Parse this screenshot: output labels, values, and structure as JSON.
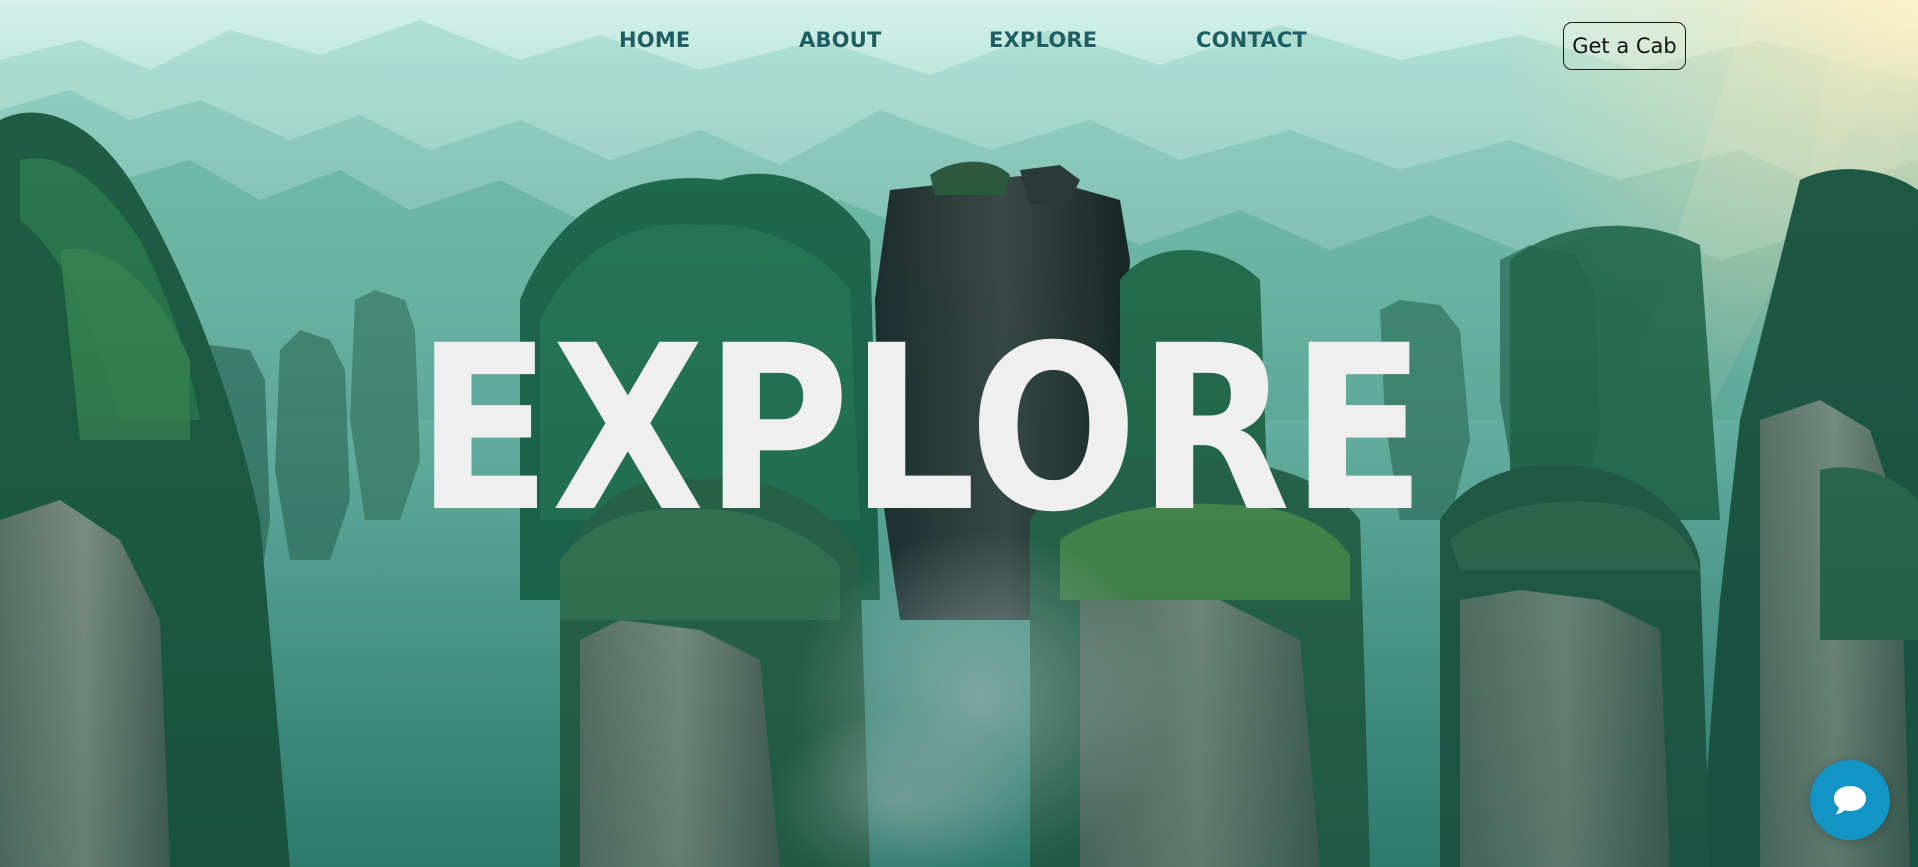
{
  "nav": {
    "links": [
      {
        "label": "HOME"
      },
      {
        "label": "ABOUT"
      },
      {
        "label": "EXPLORE"
      },
      {
        "label": "CONTACT"
      }
    ],
    "cta_label": "Get a Cab"
  },
  "hero": {
    "headline": "EXPLORE",
    "background_scene": "misty green sandstone pillar mountains"
  },
  "chat": {
    "icon": "chat-bubble-icon"
  },
  "colors": {
    "nav_text": "#1d5f61",
    "headline": "#efefef",
    "chat_button": "#1294c5",
    "scene_green": "#2f8a7b"
  }
}
